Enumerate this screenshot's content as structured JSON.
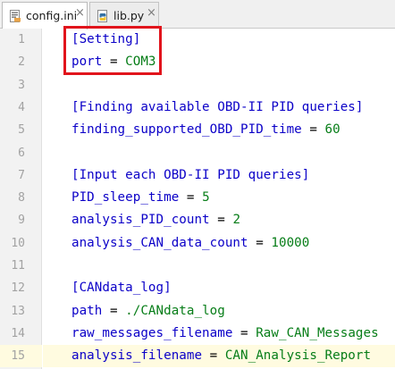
{
  "tabs": [
    {
      "label": "config.ini",
      "active": true,
      "icon": "config-file-icon",
      "close": "×"
    },
    {
      "label": "lib.py",
      "active": false,
      "icon": "python-file-icon",
      "close": "×"
    }
  ],
  "editor": {
    "current_line": 15,
    "highlight_color": "#e1141c",
    "lines": [
      {
        "n": "1",
        "section": "[Setting]"
      },
      {
        "n": "2",
        "key": "port",
        "eq": " = ",
        "value": "COM3"
      },
      {
        "n": "3"
      },
      {
        "n": "4",
        "section": "[Finding available OBD-II PID queries]"
      },
      {
        "n": "5",
        "key": "finding_supported_OBD_PID_time",
        "eq": " = ",
        "value": "60"
      },
      {
        "n": "6"
      },
      {
        "n": "7",
        "section": "[Input each OBD-II PID queries]"
      },
      {
        "n": "8",
        "key": "PID_sleep_time",
        "eq": " = ",
        "value": "5"
      },
      {
        "n": "9",
        "key": "analysis_PID_count",
        "eq": " = ",
        "value": "2"
      },
      {
        "n": "10",
        "key": "analysis_CAN_data_count",
        "eq": " = ",
        "value": "10000"
      },
      {
        "n": "11"
      },
      {
        "n": "12",
        "section": "[CANdata_log]"
      },
      {
        "n": "13",
        "key": "path",
        "eq": " = ",
        "value": "./CANdata_log"
      },
      {
        "n": "14",
        "key": "raw_messages_filename",
        "eq": " = ",
        "value": "Raw_CAN_Messages"
      },
      {
        "n": "15",
        "key": "analysis_filename",
        "eq": " = ",
        "value": "CAN_Analysis_Report"
      }
    ]
  }
}
